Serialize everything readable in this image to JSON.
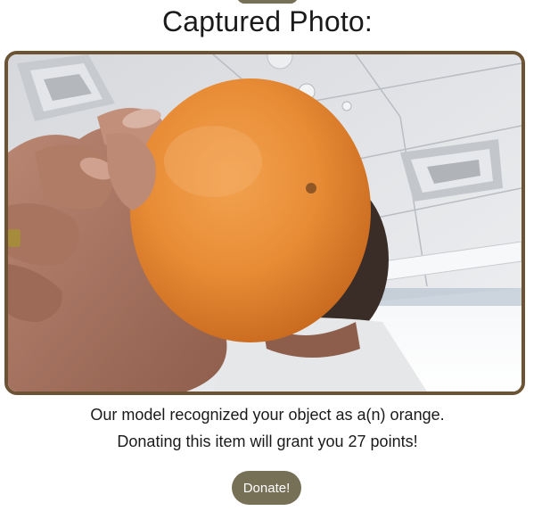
{
  "header": {
    "title": "Captured Photo:"
  },
  "photo": {
    "subject": "orange"
  },
  "result": {
    "recognition_text": "Our model recognized your object as a(n) orange.",
    "points_text": "Donating this item will grant you 27 points!"
  },
  "actions": {
    "donate_label": "Donate!"
  },
  "colors": {
    "accent_button": "#767056",
    "frame_border": "#6b5334"
  }
}
